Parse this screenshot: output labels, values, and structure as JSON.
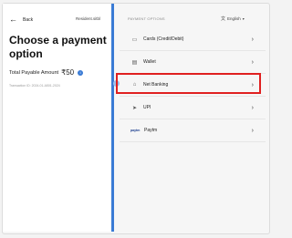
{
  "header": {
    "back_label": "Back",
    "merchant": "Resident.sitbl"
  },
  "summary": {
    "title": "Choose a payment option",
    "amount_label": "Total Payable Amount",
    "amount_value": "₹50",
    "transaction": "Transaction ID: 2024-01-A501-2024"
  },
  "payment": {
    "section_label": "PAYMENT OPTIONS",
    "language": "English",
    "options": [
      {
        "label": "Cards (Credit/Debit)",
        "icon": "card-icon"
      },
      {
        "label": "Wallet",
        "icon": "wallet-icon"
      },
      {
        "label": "Net Banking",
        "icon": "bank-icon"
      },
      {
        "label": "UPI",
        "icon": "upi-icon"
      },
      {
        "label": "Paytm",
        "icon": "paytm-logo",
        "logo_text": "paytm"
      }
    ]
  },
  "colors": {
    "accent": "#3a7bd5",
    "highlight": "#e02020"
  }
}
